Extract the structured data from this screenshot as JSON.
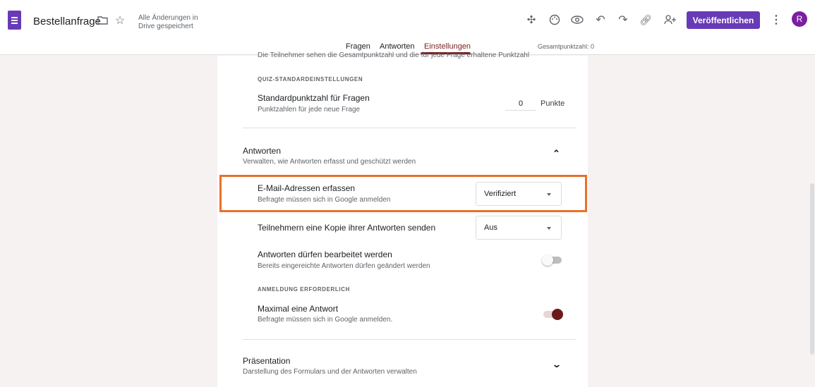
{
  "header": {
    "title": "Bestellanfrage",
    "saved_status": "Alle Änderungen in Drive gespeichert",
    "publish_label": "Veröffentlichen",
    "avatar_initial": "R",
    "brand_color": "#673ab7"
  },
  "tabs": [
    {
      "label": "Fragen"
    },
    {
      "label": "Antworten"
    },
    {
      "label": "Einstellungen",
      "active": true
    }
  ],
  "total_points": "Gesamtpunktzahl: 0",
  "settings": {
    "cut_text": "Die Teilnehmer sehen die Gesamtpunktzahl und die für jede Frage erhaltene Punktzahl",
    "quiz_defaults_caption": "QUIZ-STANDARDEINSTELLUNGEN",
    "default_points_title": "Standardpunktzahl für Fragen",
    "default_points_desc": "Punktzahlen für jede neue Frage",
    "default_points_value": "0",
    "points_unit": "Punkte",
    "responses_title": "Antworten",
    "responses_desc": "Verwalten, wie Antworten erfasst und geschützt werden",
    "collect_email_title": "E-Mail-Adressen erfassen",
    "collect_email_desc": "Befragte müssen sich in Google anmelden",
    "collect_email_value": "Verifiziert",
    "send_copy_title": "Teilnehmern eine Kopie ihrer Antworten senden",
    "send_copy_value": "Aus",
    "edit_title": "Antworten dürfen bearbeitet werden",
    "edit_desc": "Bereits eingereichte Antworten dürfen geändert werden",
    "edit_enabled": false,
    "login_caption": "ANMELDUNG ERFORDERLICH",
    "one_answer_title": "Maximal eine Antwort",
    "one_answer_desc": "Befragte müssen sich in Google anmelden.",
    "one_answer_enabled": true,
    "presentation_title": "Präsentation",
    "presentation_desc": "Darstellung des Formulars und der Antworten verwalten",
    "accent_color": "#7a1f1f",
    "highlight_color": "#e8702a"
  }
}
